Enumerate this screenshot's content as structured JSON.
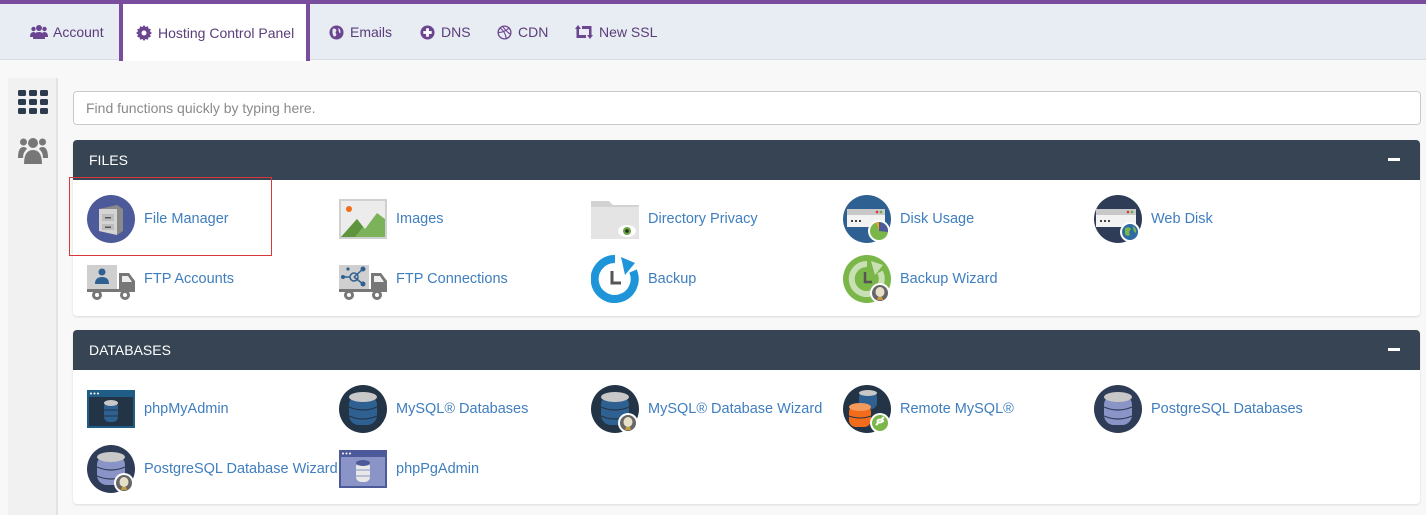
{
  "colors": {
    "accent": "#7a4c9e",
    "panel_header": "#364453",
    "link": "#3f7ebf",
    "highlight": "#d9383a"
  },
  "topnav": {
    "tabs": [
      {
        "label": "Account",
        "icon": "users-icon",
        "active": false
      },
      {
        "label": "Hosting Control Panel",
        "icon": "gear-icon",
        "active": true
      },
      {
        "label": "Emails",
        "icon": "globe-icon",
        "active": false
      },
      {
        "label": "DNS",
        "icon": "plus-circle-icon",
        "active": false
      },
      {
        "label": "CDN",
        "icon": "dribbble-icon",
        "active": false
      },
      {
        "label": "New SSL",
        "icon": "retweet-icon",
        "active": false
      }
    ]
  },
  "sidebar": {
    "items": [
      {
        "icon": "grid-icon"
      },
      {
        "icon": "users-icon"
      }
    ]
  },
  "search": {
    "placeholder": "Find functions quickly by typing here.",
    "value": ""
  },
  "sections": [
    {
      "title": "FILES",
      "collapse_symbol": "−",
      "items": [
        {
          "label": "File Manager",
          "icon": "file-manager-icon",
          "highlighted": true
        },
        {
          "label": "Images",
          "icon": "images-icon"
        },
        {
          "label": "Directory Privacy",
          "icon": "directory-privacy-icon"
        },
        {
          "label": "Disk Usage",
          "icon": "disk-usage-icon"
        },
        {
          "label": "Web Disk",
          "icon": "web-disk-icon"
        },
        {
          "label": "FTP Accounts",
          "icon": "ftp-accounts-icon"
        },
        {
          "label": "FTP Connections",
          "icon": "ftp-connections-icon"
        },
        {
          "label": "Backup",
          "icon": "backup-icon"
        },
        {
          "label": "Backup Wizard",
          "icon": "backup-wizard-icon"
        }
      ]
    },
    {
      "title": "DATABASES",
      "collapse_symbol": "−",
      "items": [
        {
          "label": "phpMyAdmin",
          "icon": "phpmyadmin-icon"
        },
        {
          "label": "MySQL® Databases",
          "icon": "mysql-databases-icon"
        },
        {
          "label": "MySQL® Database Wizard",
          "icon": "mysql-wizard-icon"
        },
        {
          "label": "Remote MySQL®",
          "icon": "remote-mysql-icon"
        },
        {
          "label": "PostgreSQL Databases",
          "icon": "postgresql-databases-icon"
        },
        {
          "label": "PostgreSQL Database Wizard",
          "icon": "postgresql-wizard-icon"
        },
        {
          "label": "phpPgAdmin",
          "icon": "phppgadmin-icon"
        }
      ]
    }
  ]
}
